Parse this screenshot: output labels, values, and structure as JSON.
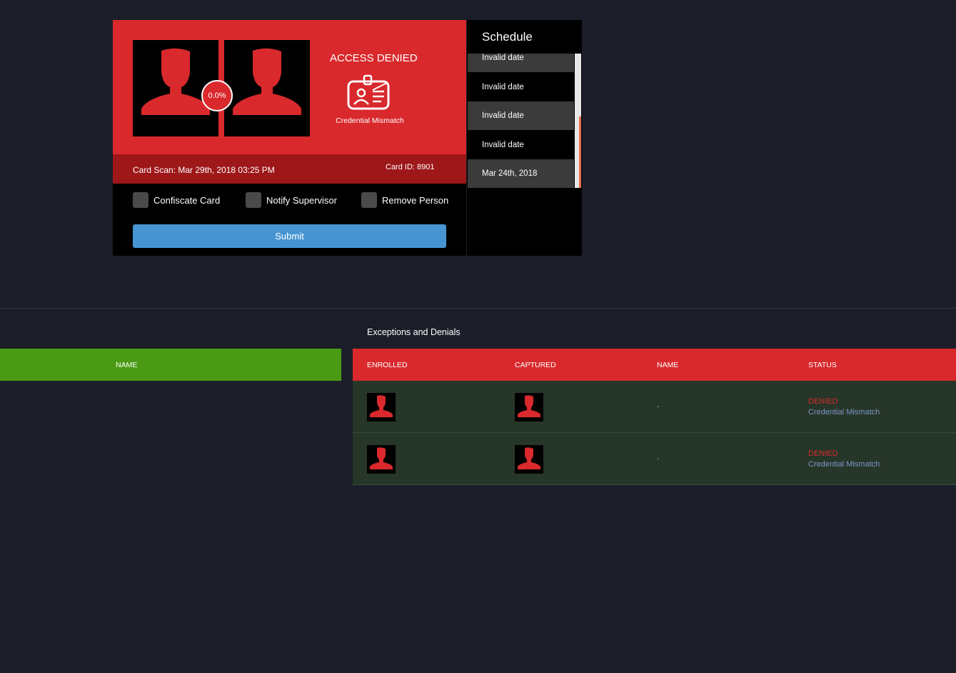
{
  "access_card": {
    "match_score": "0.0%",
    "status_title": "ACCESS DENIED",
    "reason": "Credential Mismatch",
    "card_scan": "Card Scan: Mar 29th, 2018 03:25 PM",
    "card_id": "Card ID: 8901",
    "actions": [
      {
        "label": "Confiscate Card",
        "checked": false
      },
      {
        "label": "Notify Supervisor",
        "checked": false
      },
      {
        "label": "Remove Person",
        "checked": false
      }
    ],
    "submit_label": "Submit"
  },
  "schedule": {
    "title": "Schedule",
    "items": [
      "Invalid date",
      "Invalid date",
      "Invalid date",
      "Invalid date",
      "Mar 24th, 2018"
    ]
  },
  "left_table": {
    "columns": [
      "NAME"
    ]
  },
  "exceptions": {
    "title": "Exceptions and Denials",
    "columns": [
      "ENROLLED",
      "CAPTURED",
      "NAME",
      "STATUS"
    ],
    "rows": [
      {
        "name": "-",
        "status": "DENIED",
        "reason": "Credential Mismatch"
      },
      {
        "name": "-",
        "status": "DENIED",
        "reason": "Credential Mismatch"
      }
    ]
  },
  "colors": {
    "background": "#1b1e29",
    "denied_red": "#d9292c",
    "dark_red": "#9e1719",
    "submit_blue": "#4695d2",
    "header_green": "#4b9a14",
    "row_green": "#263628",
    "reason_blue": "#7f97c9"
  },
  "icons": [
    "person-silhouette-icon",
    "id-badge-icon",
    "checkbox-icon"
  ]
}
